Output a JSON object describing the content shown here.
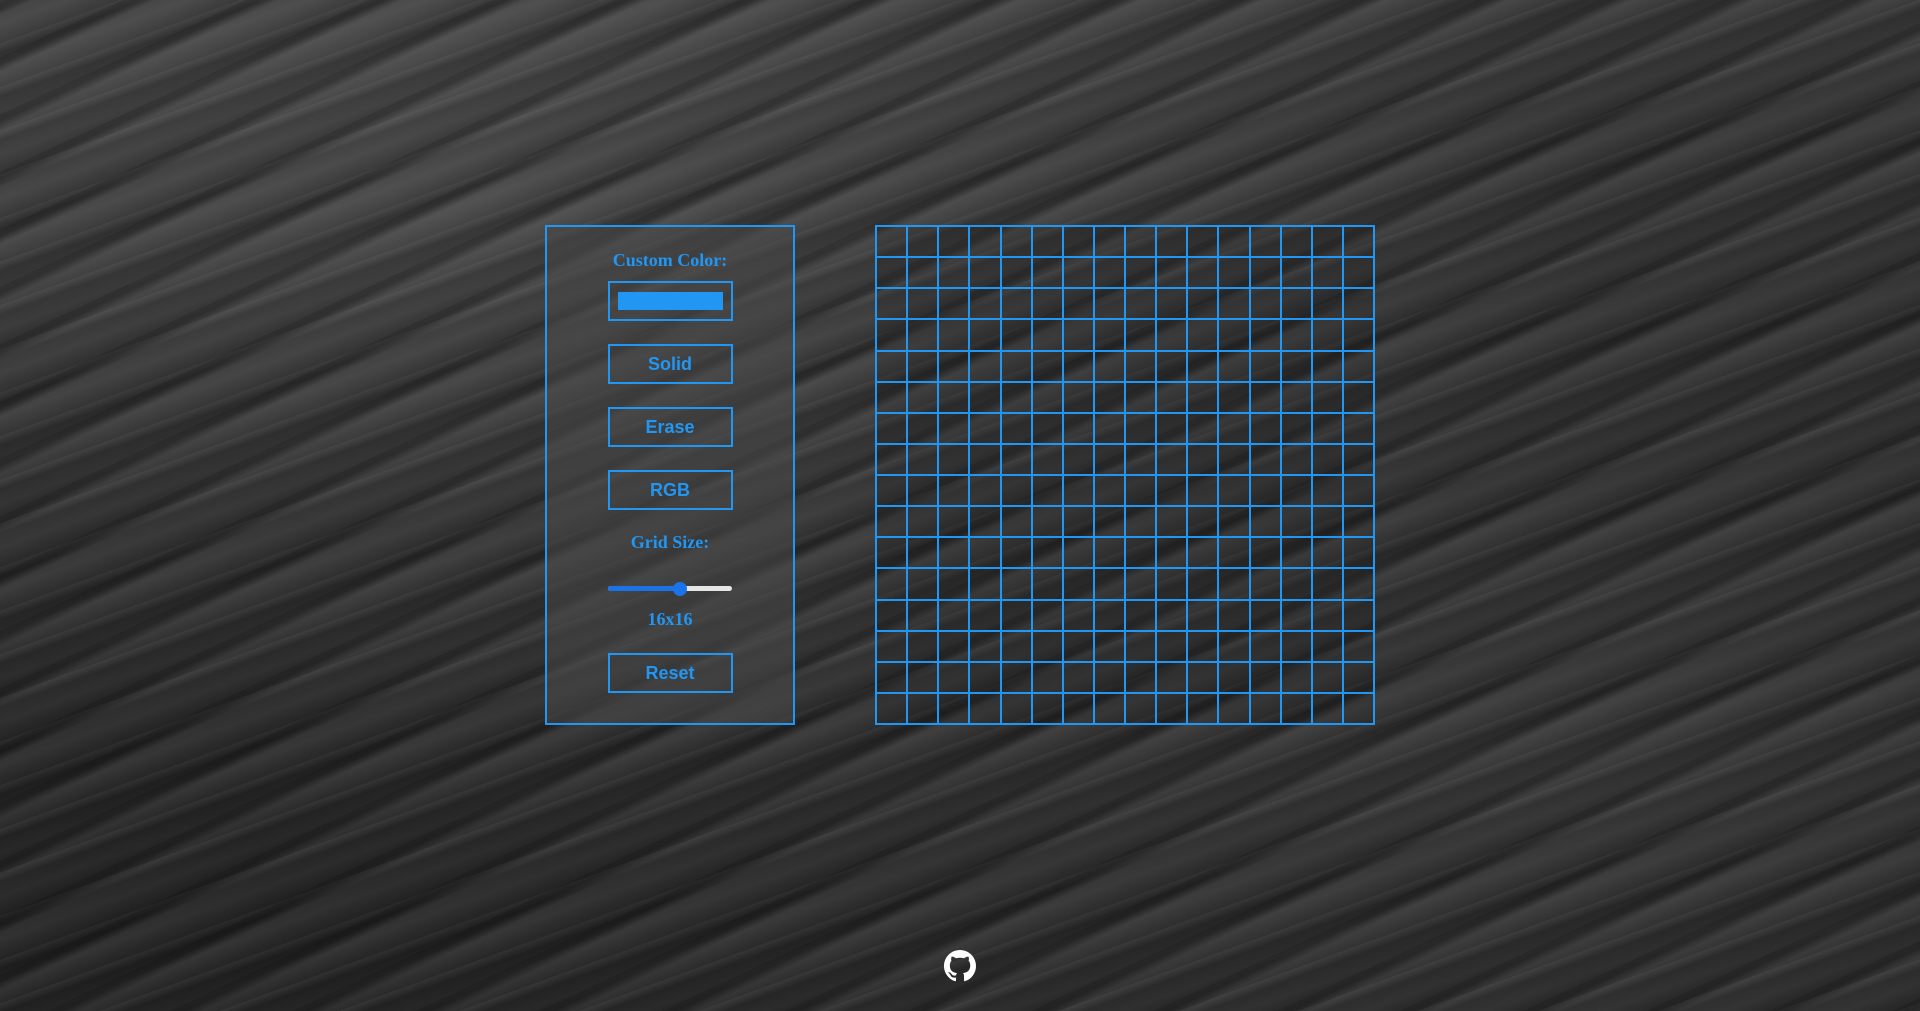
{
  "controls": {
    "custom_color_label": "Custom Color:",
    "custom_color_value": "#2196f3",
    "solid_label": "Solid",
    "erase_label": "Erase",
    "rgb_label": "RGB",
    "grid_size_label": "Grid Size:",
    "grid_size_value": 16,
    "grid_size_min": 1,
    "grid_size_max": 27,
    "grid_size_display": "16x16",
    "reset_label": "Reset"
  },
  "grid": {
    "rows": 16,
    "columns": 16
  },
  "footer": {
    "icon": "github-icon"
  },
  "colors": {
    "accent": "#2196f3",
    "slider_fill": "#1a73e8",
    "slider_track": "#e6e6e6"
  }
}
